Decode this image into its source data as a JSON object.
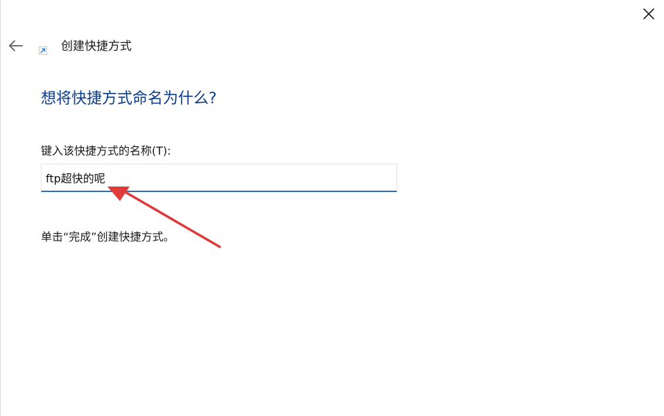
{
  "window": {
    "title": "创建快捷方式"
  },
  "main": {
    "heading": "想将快捷方式命名为什么?",
    "field_label": "键入该快捷方式的名称(T):",
    "name_value": "ftp超快的呢",
    "hint": "单击“完成”创建快捷方式。"
  },
  "icons": {
    "back": "back-arrow-icon",
    "close": "close-icon",
    "shortcut": "shortcut-overlay-icon"
  },
  "colors": {
    "heading": "#0b3d8c",
    "input_underline": "#2f6eb0",
    "annotation": "#e03a3a"
  }
}
